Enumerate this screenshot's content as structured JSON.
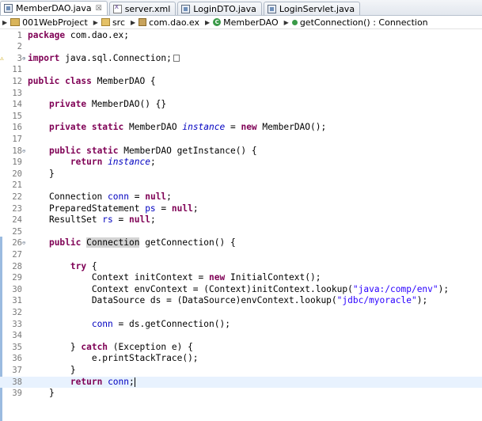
{
  "tabs": [
    {
      "label": "MemberDAO.java",
      "icon": "java-file-icon",
      "active": true,
      "close": "☒"
    },
    {
      "label": "server.xml",
      "icon": "xml-file-icon",
      "active": false
    },
    {
      "label": "LoginDTO.java",
      "icon": "java-file-icon",
      "active": false
    },
    {
      "label": "LoginServlet.java",
      "icon": "java-file-icon",
      "active": false
    }
  ],
  "breadcrumb": {
    "project": "001WebProject",
    "src": "src",
    "package": "com.dao.ex",
    "class": "MemberDAO",
    "method": "getConnection() : Connection"
  },
  "code_lines": [
    {
      "num": "1",
      "html": "<span class='kw'>package</span> com.dao.ex;"
    },
    {
      "num": "2",
      "html": ""
    },
    {
      "num": "3",
      "fold": "⊕",
      "warn": true,
      "html": "<span class='kw'>import</span> java.sql.Connection;<span class='fold-box'></span>"
    },
    {
      "num": "11",
      "html": ""
    },
    {
      "num": "12",
      "html": "<span class='kw'>public class</span> MemberDAO {"
    },
    {
      "num": "13",
      "html": ""
    },
    {
      "num": "14",
      "html": "    <span class='kw'>private</span> MemberDAO() {}"
    },
    {
      "num": "15",
      "html": ""
    },
    {
      "num": "16",
      "html": "    <span class='kw'>private static</span> MemberDAO <span class='sfld'>instance</span> = <span class='kw'>new</span> MemberDAO();"
    },
    {
      "num": "17",
      "html": ""
    },
    {
      "num": "18",
      "fold": "⊖",
      "html": "    <span class='kw'>public static</span> MemberDAO getInstance() {"
    },
    {
      "num": "19",
      "html": "        <span class='kw'>return</span> <span class='sfld'>instance</span>;"
    },
    {
      "num": "20",
      "html": "    }"
    },
    {
      "num": "21",
      "html": ""
    },
    {
      "num": "22",
      "html": "    Connection <span class='fld'>conn</span> = <span class='kw'>null</span>;"
    },
    {
      "num": "23",
      "html": "    PreparedStatement <span class='fld'>ps</span> = <span class='kw'>null</span>;"
    },
    {
      "num": "24",
      "html": "    ResultSet <span class='fld'>rs</span> = <span class='kw'>null</span>;"
    },
    {
      "num": "25",
      "html": ""
    },
    {
      "num": "26",
      "fold": "⊖",
      "html": "    <span class='kw'>public</span> <span class='hl'>Connection</span> getConnection() {"
    },
    {
      "num": "27",
      "html": ""
    },
    {
      "num": "28",
      "html": "        <span class='kw'>try</span> {"
    },
    {
      "num": "29",
      "html": "            Context initContext = <span class='kw'>new</span> InitialContext();"
    },
    {
      "num": "30",
      "html": "            Context envContext = (Context)initContext.lookup(<span class='str'>\"java:/comp/env\"</span>);"
    },
    {
      "num": "31",
      "html": "            DataSource ds = (DataSource)envContext.lookup(<span class='str'>\"jdbc/myoracle\"</span>);"
    },
    {
      "num": "32",
      "html": ""
    },
    {
      "num": "33",
      "html": "            <span class='fld'>conn</span> = ds.getConnection();"
    },
    {
      "num": "34",
      "html": ""
    },
    {
      "num": "35",
      "html": "        } <span class='kw'>catch</span> (Exception e) {"
    },
    {
      "num": "36",
      "html": "            e.printStackTrace();"
    },
    {
      "num": "37",
      "html": "        }"
    },
    {
      "num": "38",
      "current": true,
      "html": "        <span class='kw'>return</span> <span class='fld'>conn</span>;<span class='caret'></span>"
    },
    {
      "num": "39",
      "html": "    }"
    }
  ],
  "colors": {
    "keyword": "#7f0055",
    "field": "#0000c0",
    "string": "#2a00ff",
    "current_line": "#e8f2fe"
  }
}
